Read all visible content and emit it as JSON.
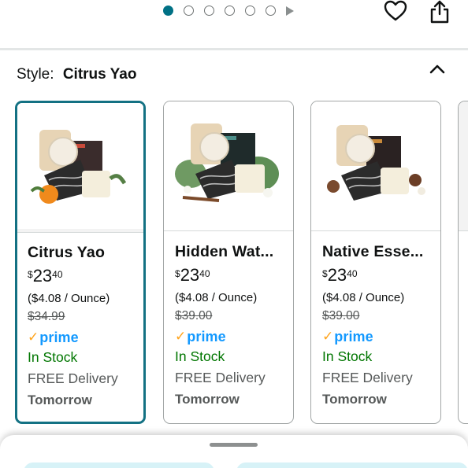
{
  "carousel": {
    "total_dots": 6,
    "active_index": 0
  },
  "style": {
    "label": "Style:",
    "value": "Citrus Yao"
  },
  "products": [
    {
      "name": "Citrus Yao",
      "price_currency": "$",
      "price_whole": "23",
      "price_fraction": "40",
      "unit_price": "($4.08 / Ounce)",
      "list_price": "$34.99",
      "prime_check": "✓",
      "prime_word": "prime",
      "stock": "In Stock",
      "delivery": "FREE Delivery",
      "delivery_day": "Tomorrow",
      "selected": true
    },
    {
      "name": "Hidden Wat...",
      "price_currency": "$",
      "price_whole": "23",
      "price_fraction": "40",
      "unit_price": "($4.08 / Ounce)",
      "list_price": "$39.00",
      "prime_check": "✓",
      "prime_word": "prime",
      "stock": "In Stock",
      "delivery": "FREE Delivery",
      "delivery_day": "Tomorrow",
      "selected": false
    },
    {
      "name": "Native Esse...",
      "price_currency": "$",
      "price_whole": "23",
      "price_fraction": "40",
      "unit_price": "($4.08 / Ounce)",
      "list_price": "$39.00",
      "prime_check": "✓",
      "prime_word": "prime",
      "stock": "In Stock",
      "delivery": "FREE Delivery",
      "delivery_day": "Tomorrow",
      "selected": false
    }
  ],
  "colors": {
    "accent": "#007185",
    "selected_border": "#137183",
    "prime_blue": "#1399ff",
    "prime_check": "#ffa41c",
    "in_stock": "#007600"
  }
}
